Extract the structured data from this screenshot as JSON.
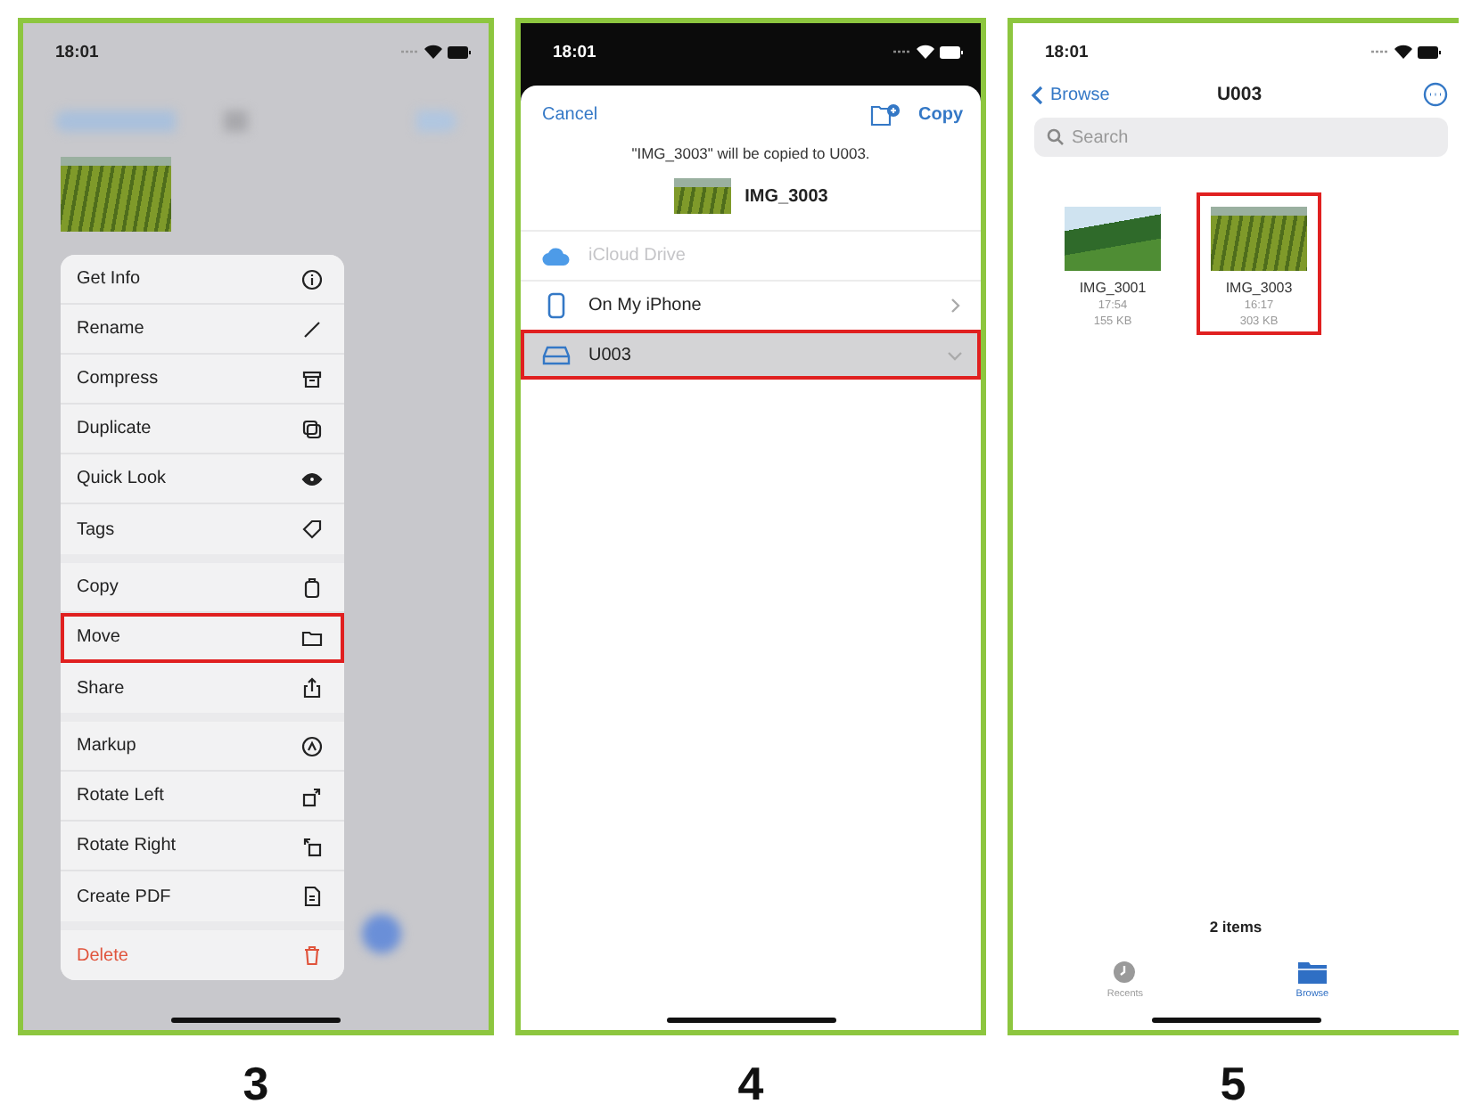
{
  "screens": [
    {
      "kind": "context_menu",
      "step": "3",
      "time": "18:01",
      "menu_groups": [
        {
          "items": [
            {
              "label": "Get Info",
              "highlighted": false,
              "destructive": false
            },
            {
              "label": "Rename",
              "highlighted": false,
              "destructive": false
            },
            {
              "label": "Compress",
              "highlighted": false,
              "destructive": false
            },
            {
              "label": "Duplicate",
              "highlighted": false,
              "destructive": false
            },
            {
              "label": "Quick Look",
              "highlighted": false,
              "destructive": false
            },
            {
              "label": "Tags",
              "highlighted": false,
              "destructive": false
            }
          ]
        },
        {
          "items": [
            {
              "label": "Copy",
              "highlighted": false,
              "destructive": false
            },
            {
              "label": "Move",
              "highlighted": true,
              "destructive": false
            },
            {
              "label": "Share",
              "highlighted": false,
              "destructive": false
            }
          ]
        },
        {
          "items": [
            {
              "label": "Markup",
              "highlighted": false,
              "destructive": false
            },
            {
              "label": "Rotate Left",
              "highlighted": false,
              "destructive": false
            },
            {
              "label": "Rotate Right",
              "highlighted": false,
              "destructive": false
            },
            {
              "label": "Create PDF",
              "highlighted": false,
              "destructive": false
            }
          ]
        },
        {
          "items": [
            {
              "label": "Delete",
              "highlighted": false,
              "destructive": true
            }
          ]
        }
      ]
    },
    {
      "kind": "copy_sheet",
      "step": "4",
      "time": "18:01",
      "cancel": "Cancel",
      "confirm": "Copy",
      "message": "\"IMG_3003\" will be copied to U003.",
      "file_name": "IMG_3003",
      "locations": [
        {
          "label": "iCloud Drive",
          "disabled": true,
          "selected": false,
          "highlighted": false
        },
        {
          "label": "On My iPhone",
          "disabled": false,
          "expanded": false,
          "selected": false,
          "highlighted": false
        },
        {
          "label": "U003",
          "disabled": false,
          "expanded": true,
          "selected": true,
          "highlighted": true
        }
      ]
    },
    {
      "kind": "folder_view",
      "step": "5",
      "time": "18:01",
      "back": "Browse",
      "title": "U003",
      "search": {
        "placeholder": "Search"
      },
      "files": [
        {
          "name": "IMG_3001",
          "time": "17:54",
          "size": "155 KB",
          "highlighted": false
        },
        {
          "name": "IMG_3003",
          "time": "16:17",
          "size": "303 KB",
          "highlighted": true
        }
      ],
      "item_count": "2 items",
      "tabs": [
        {
          "label": "Recents",
          "selected": false
        },
        {
          "label": "Browse",
          "selected": true
        }
      ]
    }
  ]
}
